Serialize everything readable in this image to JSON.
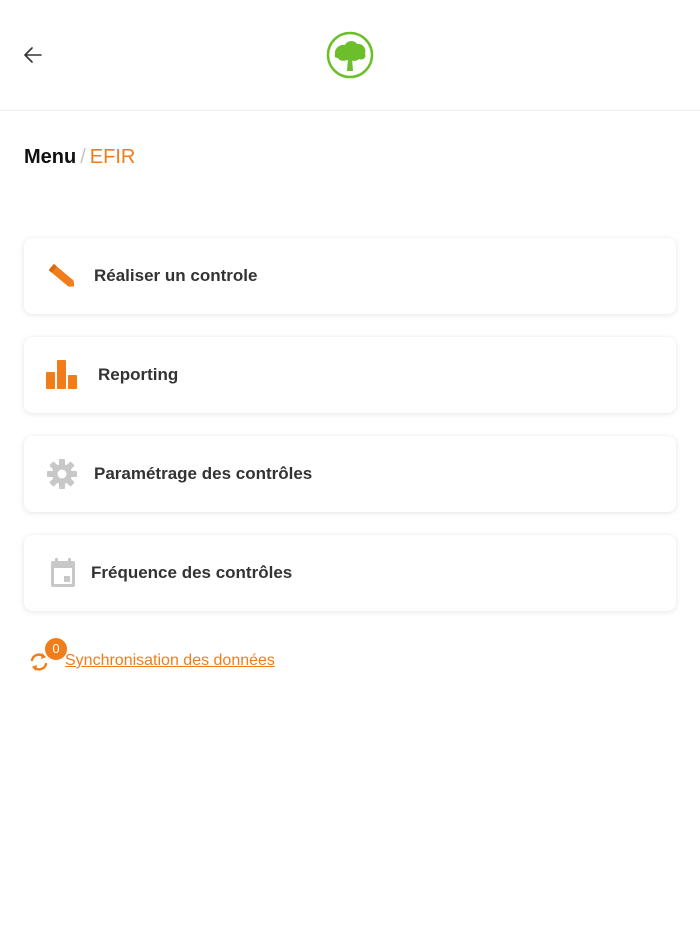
{
  "header": {
    "back_icon": "arrow-left-icon",
    "logo_icon": "tree-logo-icon"
  },
  "breadcrumb": {
    "root": "Menu",
    "separator": "/",
    "current": "EFIR"
  },
  "menu": {
    "items": [
      {
        "label": "Réaliser un controle",
        "icon": "pencil-icon"
      },
      {
        "label": "Reporting",
        "icon": "bar-chart-icon"
      },
      {
        "label": "Paramétrage des contrôles",
        "icon": "gear-icon"
      },
      {
        "label": "Fréquence des contrôles",
        "icon": "calendar-icon"
      }
    ]
  },
  "sync": {
    "count": "0",
    "label": "Synchronisation des données",
    "icon": "sync-icon"
  },
  "colors": {
    "accent": "#f07d1a",
    "logo_green": "#6cbf2a",
    "disabled_icon": "#c8c8c8"
  }
}
